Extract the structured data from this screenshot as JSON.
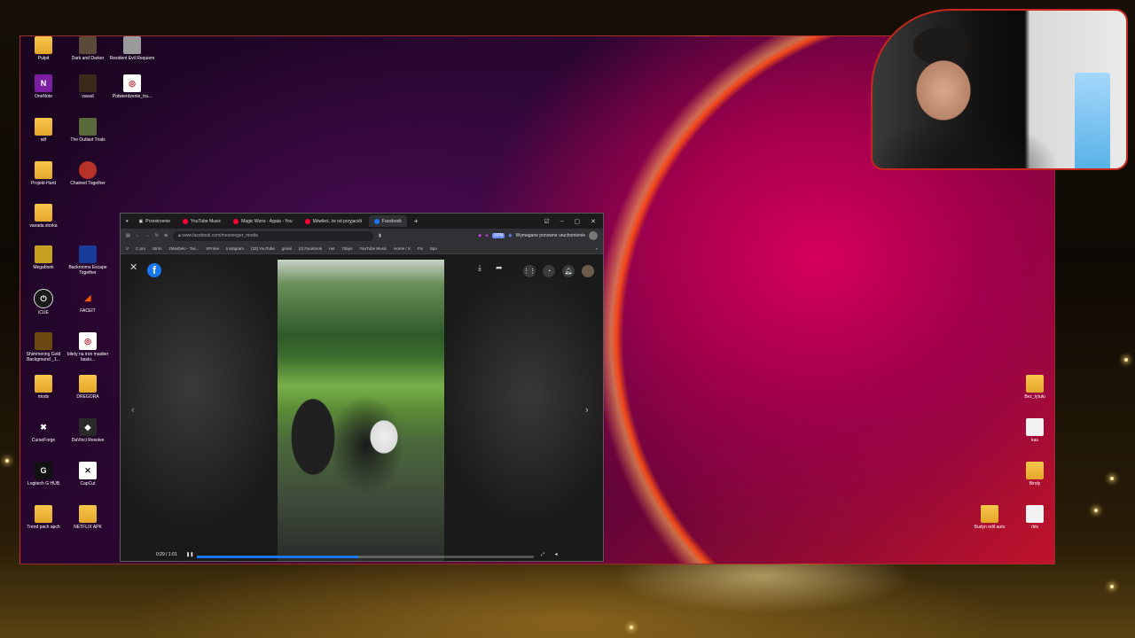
{
  "desktop": {
    "icons_left": [
      {
        "label": "Pulpit",
        "icon": "folder-icon",
        "kind": "folder"
      },
      {
        "label": "Dark and Darker",
        "icon": "app-icon",
        "kind": "app",
        "color": "#5a4a3a"
      },
      {
        "label": "Resident Evil Requiem",
        "icon": "app-icon",
        "kind": "app",
        "color": "#9a9a9a"
      },
      {
        "label": "OneNote",
        "icon": "onenote-icon",
        "kind": "app",
        "color": "#7a1fa2"
      },
      {
        "label": "vavad",
        "icon": "app-icon",
        "kind": "app",
        "color": "#3a2a1a"
      },
      {
        "label": "Potwierdzenie_tra...",
        "icon": "pdf-icon",
        "kind": "doc"
      },
      {
        "label": "wtf",
        "icon": "folder-icon",
        "kind": "folder"
      },
      {
        "label": "The Outlast Trials",
        "icon": "app-icon",
        "kind": "app",
        "color": "#5a6a3a"
      },
      {
        "label": "Projekt-Hard",
        "icon": "folder-icon",
        "kind": "folder"
      },
      {
        "label": "Chained Together",
        "icon": "app-icon",
        "kind": "app",
        "color": "#b8322a"
      },
      {
        "label": "vavada storka",
        "icon": "folder-icon",
        "kind": "folder"
      },
      {
        "label": "Megabonk",
        "icon": "app-icon",
        "kind": "app",
        "color": "#c8a020"
      },
      {
        "label": "Backrooms Escape Together",
        "icon": "app-icon",
        "kind": "app",
        "color": "#1a3a9a"
      },
      {
        "label": "iCUE",
        "icon": "app-icon",
        "kind": "app",
        "color": "#1a1a1a"
      },
      {
        "label": "FACEIT",
        "icon": "app-icon",
        "kind": "app",
        "color": "#ff5500"
      },
      {
        "label": "Shimmering Gold Background _1...",
        "icon": "video-icon",
        "kind": "app",
        "color": "#6a4a10"
      },
      {
        "label": "bilety na iron maiden basiu...",
        "icon": "pdf-icon",
        "kind": "doc"
      },
      {
        "label": "mods",
        "icon": "folder-icon",
        "kind": "folder"
      },
      {
        "label": "DREGORA",
        "icon": "folder-icon",
        "kind": "folder"
      },
      {
        "label": "CurseForge",
        "icon": "app-icon",
        "kind": "app",
        "color": "#1a1a1a"
      },
      {
        "label": "DaVinci Resolve",
        "icon": "app-icon",
        "kind": "app",
        "color": "#2a2a2a"
      },
      {
        "label": "Logitech G HUB",
        "icon": "app-icon",
        "kind": "app",
        "color": "#111"
      },
      {
        "label": "CapCut",
        "icon": "app-icon",
        "kind": "app",
        "color": "#fff"
      },
      {
        "label": "Trend pach apch",
        "icon": "folder-icon",
        "kind": "folder"
      },
      {
        "label": "NETFLIX APK",
        "icon": "folder-icon",
        "kind": "folder"
      }
    ],
    "icons_right": [
      {
        "label": "Bez_tytułu",
        "icon": "folder-icon",
        "kind": "folder"
      },
      {
        "label": "kas",
        "icon": "file-icon",
        "kind": "blank"
      },
      {
        "label": "Bindy",
        "icon": "folder-icon",
        "kind": "folder"
      },
      {
        "label": "Budyn edit auto",
        "icon": "folder-icon",
        "kind": "folder"
      },
      {
        "label": "rblx",
        "icon": "file-icon",
        "kind": "blank"
      }
    ]
  },
  "browser": {
    "tabs": [
      {
        "label": "Przestrzenie",
        "color": "#888888"
      },
      {
        "label": "YouTube Music",
        "color": "#ff0033"
      },
      {
        "label": "Magic Wons - Agata - You",
        "color": "#ff0033"
      },
      {
        "label": "Mówiłeś, że od przyjaciół",
        "color": "#ff0033"
      },
      {
        "label": "Facebook",
        "color": "#1877f2",
        "active": true
      }
    ],
    "new_tab": "+",
    "url": "www.facebook.com/messenger_media",
    "restart_notice": "Wymagane ponowne uruchomienie",
    "bookmarks": [
      "V",
      "C pro",
      "Strim",
      "zMasbelo - Twi...",
      "XPrime",
      "Instagram",
      "(33) YouTube",
      "gmail",
      "(2) Facebook",
      "net",
      "7days",
      "YouTube Music",
      "Home / X",
      "Fix",
      "Spo"
    ]
  },
  "viewer": {
    "time": "0:29 / 1:01",
    "progress": 0.48
  },
  "colors": {
    "facebook_blue": "#1877f2",
    "webcam_border": "#c8281c"
  }
}
